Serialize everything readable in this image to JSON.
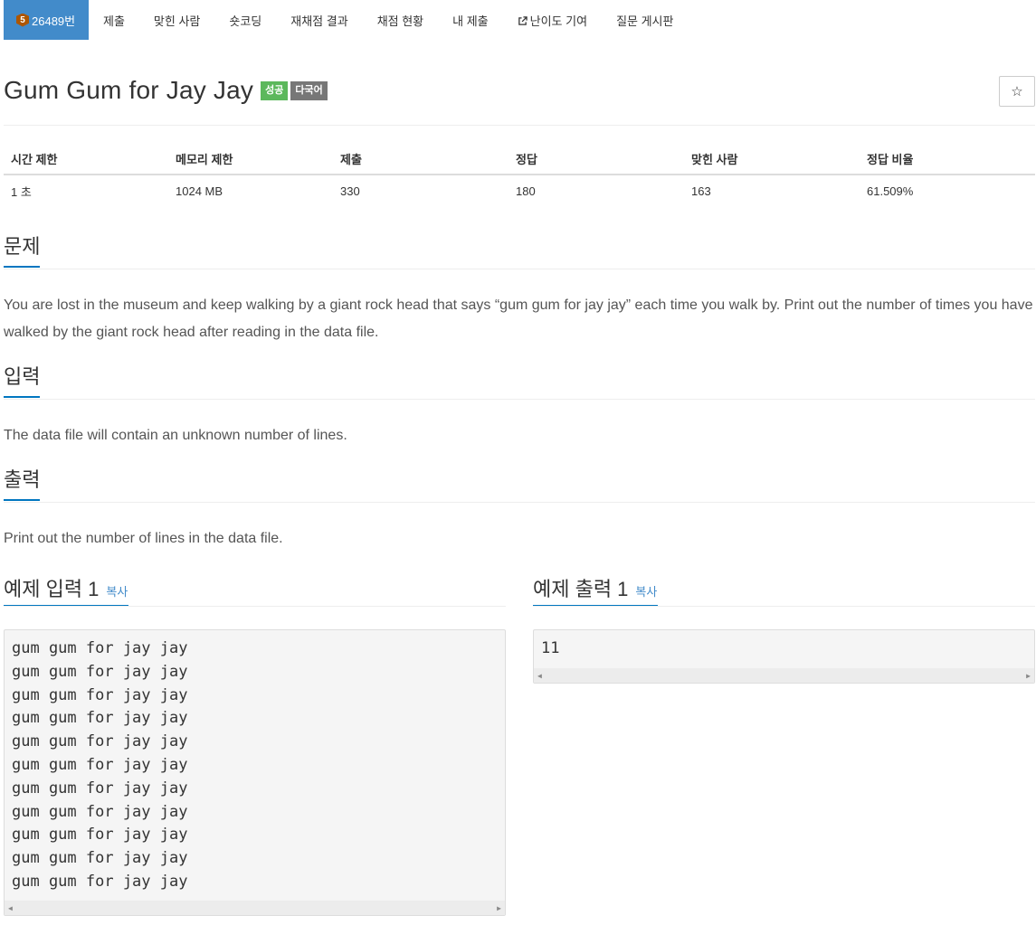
{
  "nav": {
    "problem_id": "26489번",
    "tier": "5",
    "items": [
      "제출",
      "맞힌 사람",
      "숏코딩",
      "재채점 결과",
      "채점 현황",
      "내 제출",
      "난이도 기여",
      "질문 게시판"
    ]
  },
  "problem": {
    "title": "Gum Gum for Jay Jay",
    "labels": [
      "성공",
      "다국어"
    ],
    "star": "☆"
  },
  "info": {
    "headers": [
      "시간 제한",
      "메모리 제한",
      "제출",
      "정답",
      "맞힌 사람",
      "정답 비율"
    ],
    "values": [
      "1 초",
      "1024 MB",
      "330",
      "180",
      "163",
      "61.509%"
    ]
  },
  "sections": {
    "description_title": "문제",
    "description": "You are lost in the museum and keep walking by a giant rock head that says “gum gum for jay jay” each time you walk by. Print out the number of times you have walked by the giant rock head after reading in the data file.",
    "input_title": "입력",
    "input": "The data file will contain an unknown number of lines.",
    "output_title": "출력",
    "output": "Print out the number of lines in the data file."
  },
  "samples": {
    "copy_label": "복사",
    "input_title": "예제 입력 1",
    "output_title": "예제 출력 1",
    "input_lines": [
      "gum gum for jay jay",
      "gum gum for jay jay",
      "gum gum for jay jay",
      "gum gum for jay jay",
      "gum gum for jay jay",
      "gum gum for jay jay",
      "gum gum for jay jay",
      "gum gum for jay jay",
      "gum gum for jay jay",
      "gum gum for jay jay",
      "gum gum for jay jay"
    ],
    "output_lines": [
      "11"
    ]
  },
  "colors": {
    "nav_active": "#428bca",
    "success": "#5cb85c",
    "default_label": "#777777",
    "accent_underline": "#0076c0"
  }
}
